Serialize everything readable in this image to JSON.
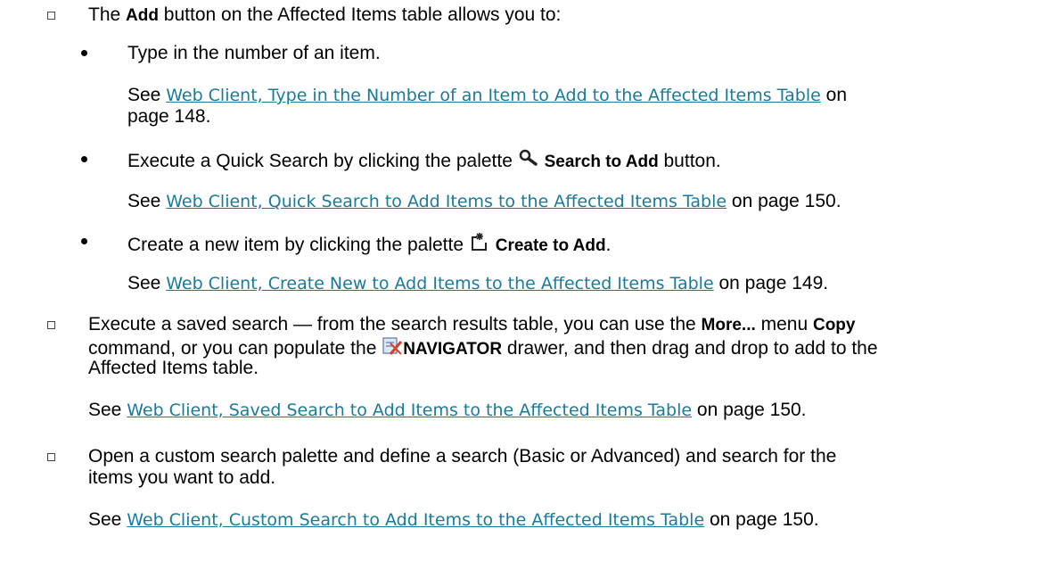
{
  "item1": {
    "prefix": "The ",
    "bold": "Add",
    "suffix": " button on the Affected Items table allows you to:",
    "sub1": {
      "text": "Type in the number of an item.",
      "see": "See ",
      "link": "Web Client, Type in the Number of an Item to Add to the Affected Items Table",
      "on": " on",
      "page": "page 148."
    },
    "sub2": {
      "prefix": "Execute a Quick Search by clicking the palette ",
      "bold": "Search to Add",
      "suffix": " button.",
      "icon": "magnifier-icon",
      "see": "See ",
      "link": "Web Client, Quick Search to Add Items to the Affected Items Table",
      "page": " on page 150."
    },
    "sub3": {
      "prefix": "Create a new item by clicking the palette ",
      "bold": "Create to Add",
      "suffix": ".",
      "icon": "create-new-icon",
      "see": "See ",
      "link": "Web Client, Create New to Add Items to the Affected Items Table",
      "page": " on page 149."
    }
  },
  "item2": {
    "prefix": "Execute a saved search — from the search results table, you can use the ",
    "bold1": "More...",
    "mid": " menu ",
    "bold2": "Copy",
    "line2_prefix": "command, or you can populate the ",
    "bold3": "NAVIGATOR",
    "line2_suffix": " drawer, and then drag and drop to add to the",
    "line3": "Affected Items table.",
    "icon": "navigator-icon",
    "see": "See ",
    "link": "Web Client, Saved Search to Add Items to the Affected Items Table",
    "page": " on page 150."
  },
  "item3": {
    "line1": "Open a custom search palette and define a search (Basic or Advanced) and search for the",
    "line2": "items you want to add.",
    "see": "See ",
    "link": "Web Client, Custom Search to Add Items to the Affected Items Table",
    "page": " on page 150."
  }
}
